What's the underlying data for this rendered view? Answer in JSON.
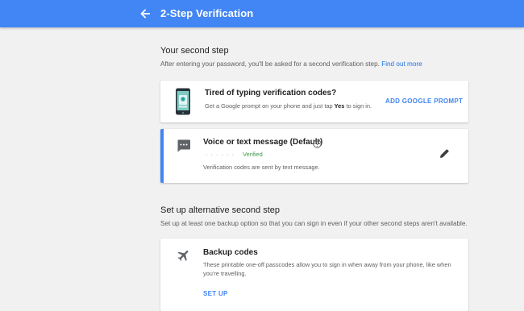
{
  "header": {
    "title": "2-Step Verification",
    "back_icon": "arrow-back-icon"
  },
  "second_step": {
    "heading": "Your second step",
    "description": "After entering your password, you'll be asked for a second verification step.",
    "link": "Find out more"
  },
  "prompt_card": {
    "title": "Tired of typing verification codes?",
    "text_before": "Get a Google prompt on your phone and just tap ",
    "text_bold": "Yes",
    "text_after": " to sign in.",
    "action": "ADD GOOGLE PROMPT",
    "icon": "phone-prompt-icon"
  },
  "sms_card": {
    "title": "Voice or text message (Default)",
    "masked_number": "·  ·  ·  ·  ·  ·",
    "status": "Verified",
    "text": "Verification codes are sent by text message.",
    "icons": [
      "message-icon",
      "help-icon",
      "edit-icon"
    ]
  },
  "alternative": {
    "heading": "Set up alternative second step",
    "description": "Set up at least one backup option so that you can sign in even if your other second steps aren't available."
  },
  "backup_card": {
    "title": "Backup codes",
    "text_line1": "These printable one-off passcodes allow you to sign in when away from your phone, like when",
    "text_line2": "you're travelling.",
    "action": "SET UP",
    "icon": "airplane-icon"
  },
  "colors": {
    "header": "#4285f4",
    "accent": "#4285f4",
    "verified": "#3f9b4b",
    "link": "#1a73e8"
  }
}
